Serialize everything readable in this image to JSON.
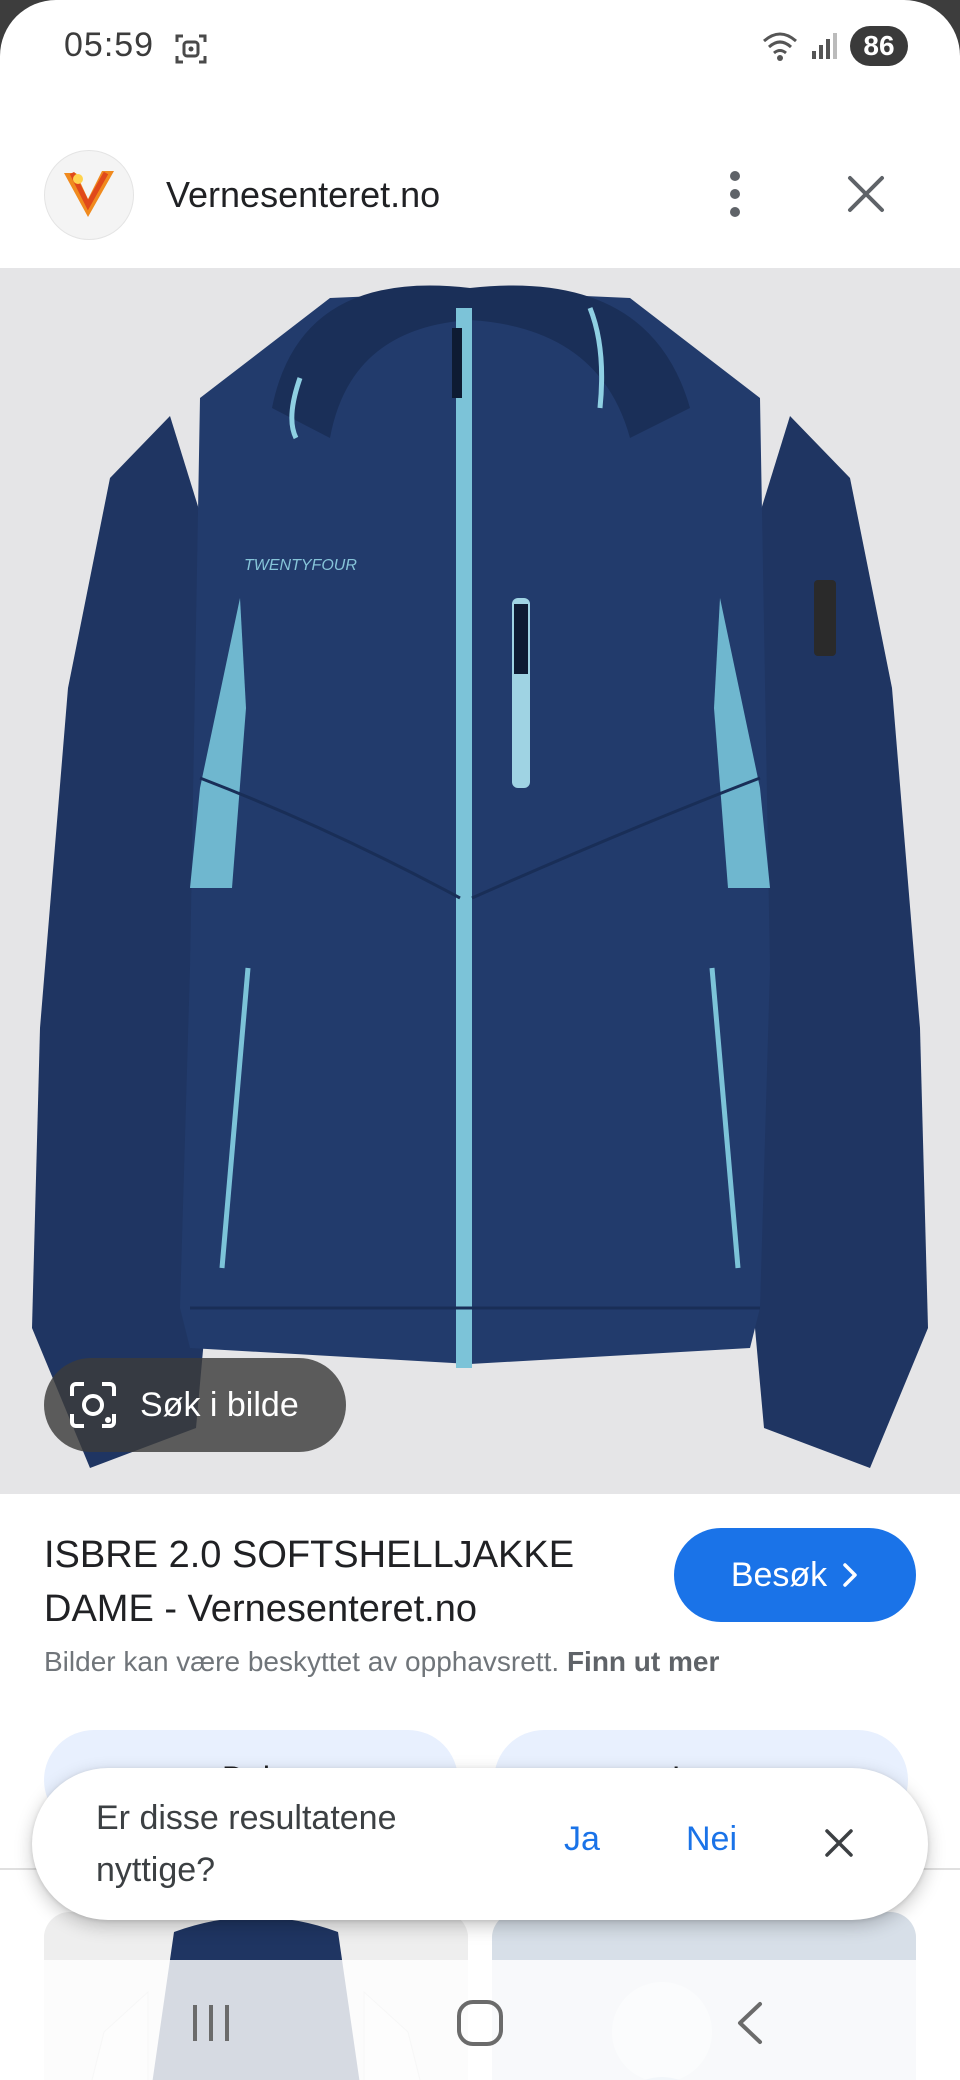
{
  "status_bar": {
    "time": "05:59",
    "battery": "86",
    "icons": [
      "screen-record-icon",
      "wifi-icon",
      "signal-icon"
    ]
  },
  "header": {
    "site_name": "Vernesenteret.no",
    "logo_icon": "vernesenteret-logo-icon",
    "more_icon": "more-vert-icon",
    "close_icon": "close-icon"
  },
  "image": {
    "brand_text": "TWENTYFOUR",
    "lens_label": "Søk i bilde",
    "colors": {
      "jacket": "#1f3562",
      "accent": "#6fb7cf",
      "background": "#e5e5e7"
    }
  },
  "result": {
    "title_line1": "ISBRE 2.0 SOFTSHELLJAKKE",
    "title_line2": "DAME - Vernesenteret.no",
    "visit_label": "Besøk",
    "copyright_text": "Bilder kan være beskyttet av opphavsrett.",
    "learn_more": "Finn ut mer"
  },
  "actions": [
    {
      "label": "Del",
      "icon": "share-icon"
    },
    {
      "label": "Lagre",
      "icon": "bookmark-icon"
    }
  ],
  "feedback": {
    "question": "Er disse resultatene nyttige?",
    "yes": "Ja",
    "no": "Nei"
  },
  "colors": {
    "primary": "#1a73e8",
    "text": "#202124",
    "muted": "#70757a"
  }
}
